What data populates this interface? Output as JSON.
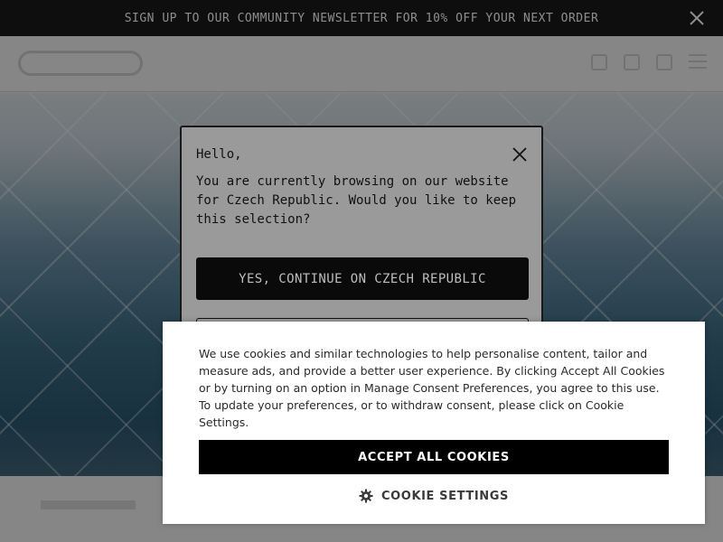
{
  "promo": {
    "text": "SIGN UP TO OUR COMMUNITY NEWSLETTER FOR 10% OFF YOUR NEXT ORDER",
    "close_icon": "close-icon"
  },
  "header": {
    "logo_icon": "brand-logo",
    "icons": [
      "search-icon",
      "account-icon",
      "bag-icon",
      "menu-icon"
    ]
  },
  "region_modal": {
    "greeting": "Hello,",
    "message": "You are currently browsing on our website for Czech Republic. Would you like to keep this selection?",
    "confirm_label": "YES, CONTINUE ON CZECH REPUBLIC",
    "close_icon": "close-icon"
  },
  "cookie_banner": {
    "text": "We use cookies and similar technologies to help personalise content, tailor and measure ads, and provide a better user experience. By clicking Accept All Cookies or by turning on an option in Manage Consent Preferences, you agree to this use. To update your preferences, or to withdraw consent, please click on Cookie Settings.",
    "accept_label": "ACCEPT ALL COOKIES",
    "settings_label": "COOKIE SETTINGS",
    "settings_icon": "gear-icon"
  },
  "colors": {
    "overlay": "#000000",
    "button_dark": "#000000",
    "banner_bg": "#ffffff"
  }
}
